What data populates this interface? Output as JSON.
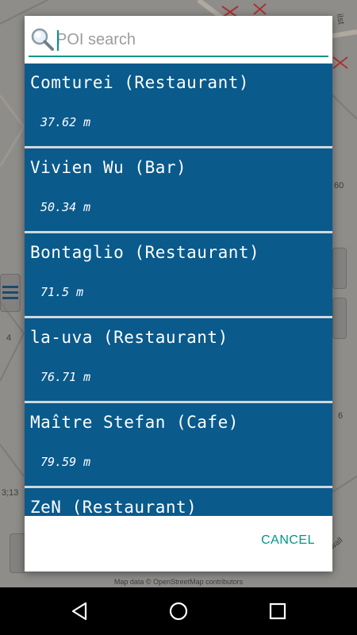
{
  "map": {
    "credit": "Map data © OpenStreetMap contributors",
    "numbers": [
      "60",
      "4",
      "6",
      "3;13",
      "ilst"
    ],
    "street_label": "Rotenwall"
  },
  "search": {
    "placeholder": "POI search",
    "value": ""
  },
  "results": [
    {
      "name": "Comturei (Restaurant)",
      "distance": "37.62 m"
    },
    {
      "name": "Vivien Wu (Bar)",
      "distance": "50.34 m"
    },
    {
      "name": "Bontaglio (Restaurant)",
      "distance": "71.5 m"
    },
    {
      "name": "la-uva (Restaurant)",
      "distance": "76.71 m"
    },
    {
      "name": "Maître Stefan (Cafe)",
      "distance": "79.59 m"
    },
    {
      "name": "ZeN (Restaurant)",
      "distance": ""
    }
  ],
  "dialog": {
    "cancel_label": "CANCEL"
  },
  "colors": {
    "item_bg": "#0a5a8c",
    "accent": "#009688"
  },
  "navbar": {
    "icons": [
      "back-icon",
      "home-icon",
      "recents-icon"
    ]
  }
}
